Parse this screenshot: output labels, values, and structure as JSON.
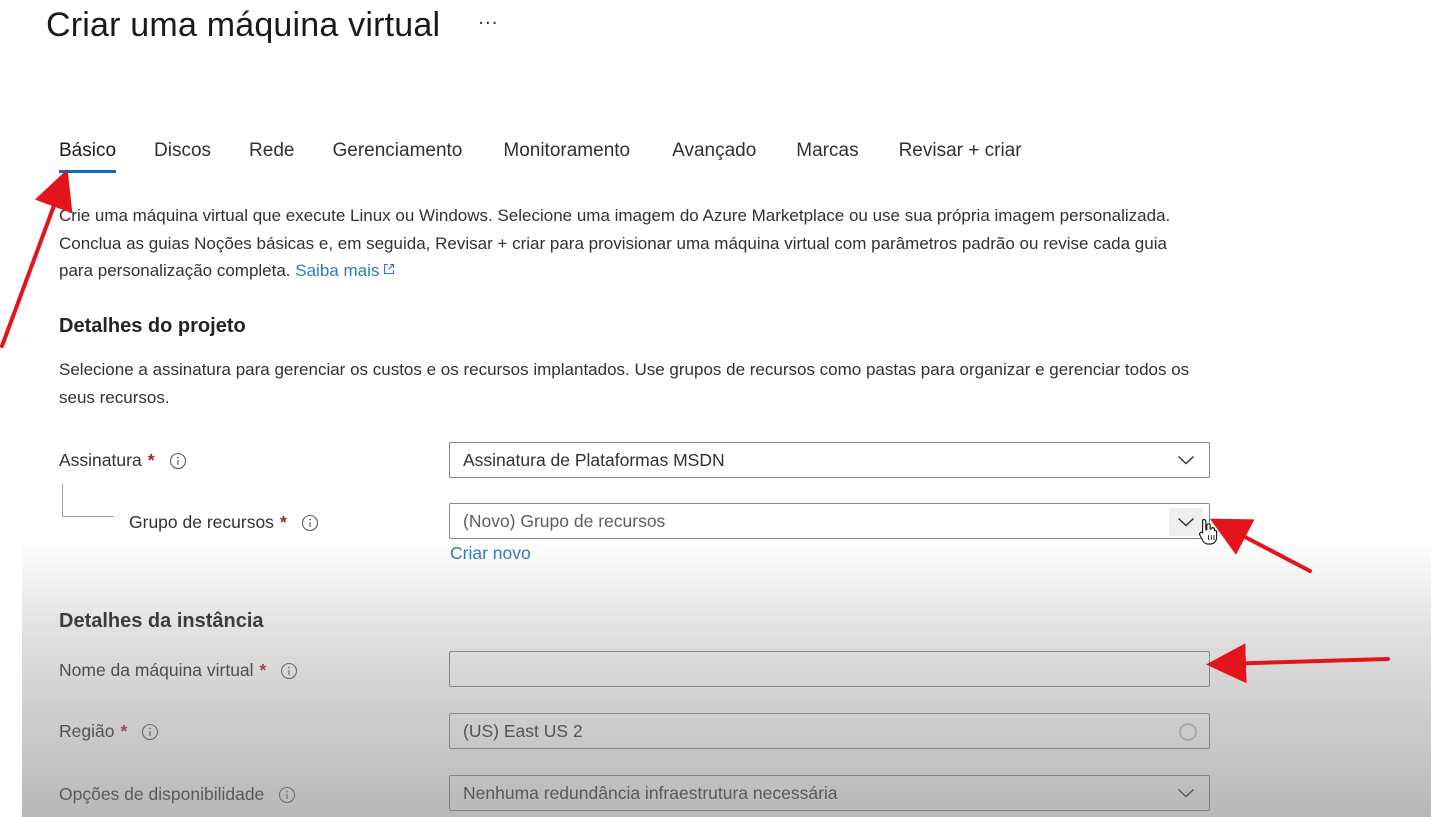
{
  "header": {
    "title": "Criar uma máquina virtual",
    "more_label": "···"
  },
  "tabs": [
    {
      "label": "Básico",
      "active": true
    },
    {
      "label": "Discos"
    },
    {
      "label": "Rede"
    },
    {
      "label": "Gerenciamento"
    },
    {
      "label": "Monitoramento"
    },
    {
      "label": "Avançado"
    },
    {
      "label": "Marcas"
    },
    {
      "label": "Revisar + criar"
    }
  ],
  "intro": {
    "text": "Crie uma máquina virtual que execute Linux ou Windows. Selecione uma imagem do Azure Marketplace ou use sua própria imagem personalizada. Conclua as guias Noções básicas e, em seguida, Revisar + criar para provisionar uma máquina virtual com parâmetros padrão ou revise cada guia para personalização completa.",
    "learn_more": "Saiba mais"
  },
  "project": {
    "title": "Detalhes do projeto",
    "description": "Selecione a assinatura para gerenciar os custos e os recursos implantados. Use grupos de recursos como pastas para organizar e gerenciar todos os seus recursos.",
    "subscription_label": "Assinatura",
    "subscription_value": "Assinatura de Plataformas MSDN",
    "resource_group_label": "Grupo de recursos",
    "resource_group_placeholder": "(Novo) Grupo de recursos",
    "create_new": "Criar novo"
  },
  "instance": {
    "title": "Detalhes da instância",
    "vm_name_label": "Nome da máquina virtual",
    "vm_name_value": "",
    "region_label": "Região",
    "region_value": "(US) East US 2",
    "availability_label": "Opções de disponibilidade",
    "availability_value": "Nenhuma redundância infraestrutura necessária"
  },
  "required_marker": "*",
  "colors": {
    "accent": "#0f6cbd",
    "link": "#2b7bc6",
    "required": "#a4262c",
    "annotation_arrow": "#e3141b"
  },
  "icons": [
    "more-icon",
    "external-link-icon",
    "info-icon",
    "chevron-down-icon",
    "loading-spinner-icon",
    "hand-cursor-icon",
    "red-arrow-annotation"
  ]
}
